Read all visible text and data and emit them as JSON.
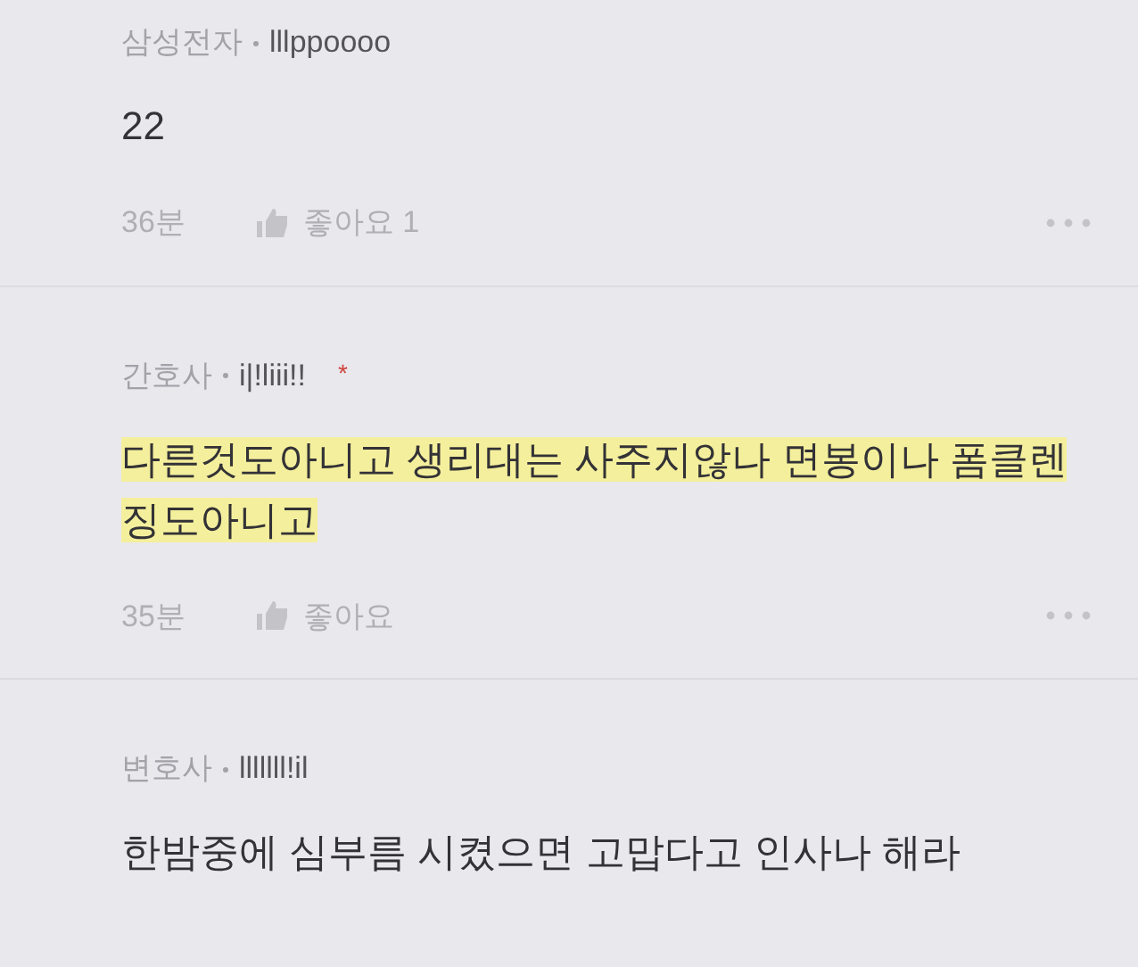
{
  "comments": [
    {
      "company": "삼성전자",
      "nickname": "lllppoooo",
      "text": "22",
      "highlighted": false,
      "time": "36분",
      "likes": "좋아요 1"
    },
    {
      "company": "간호사",
      "nickname": "i|!liii!!",
      "mark": "*",
      "text": "다른것도아니고 생리대는 사주지않나 면봉이나 폼클렌징도아니고",
      "highlighted": true,
      "time": "35분",
      "likes": "좋아요"
    },
    {
      "company": "변호사",
      "nickname": "lllllll!il",
      "text": "한밤중에 심부름 시켰으면 고맙다고 인사나 해라",
      "highlighted": false
    }
  ]
}
